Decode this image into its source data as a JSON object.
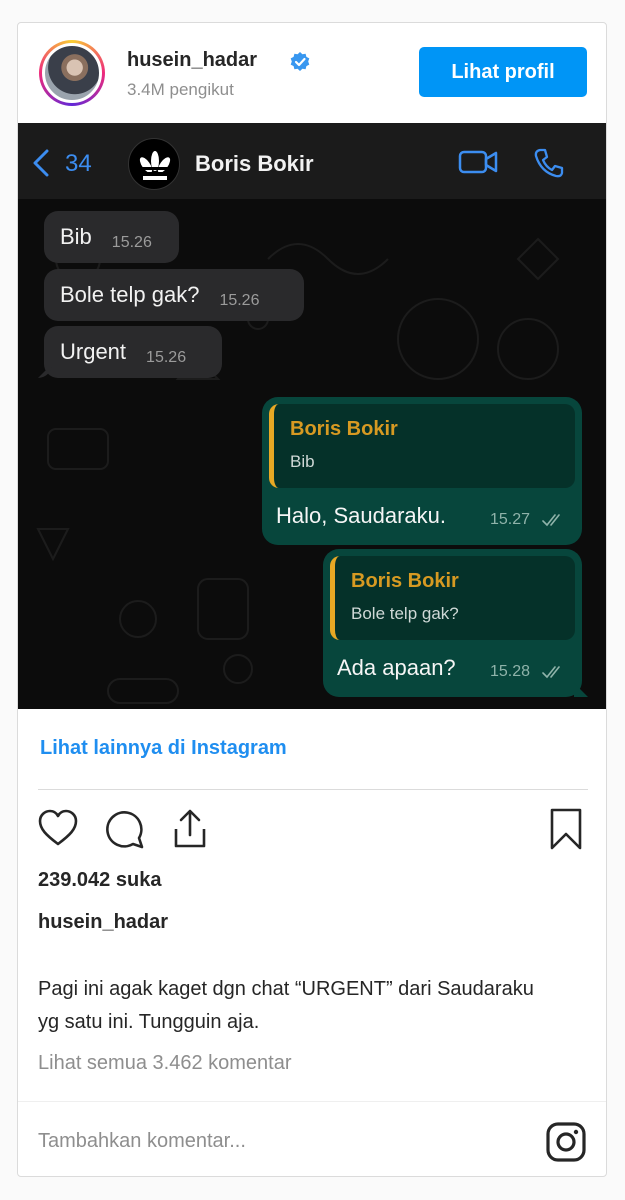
{
  "header": {
    "username": "husein_hadar",
    "followers": "3.4M pengikut",
    "view_profile_label": "Lihat profil",
    "verified_icon": "verified-badge-icon"
  },
  "chat": {
    "back_count": "34",
    "contact_name": "Boris Bokir",
    "incoming": [
      {
        "text": "Bib",
        "time": "15.26"
      },
      {
        "text": "Bole telp gak?",
        "time": "15.26"
      },
      {
        "text": "Urgent",
        "time": "15.26"
      }
    ],
    "outgoing": [
      {
        "quote_name": "Boris Bokir",
        "quote_text": "Bib",
        "text": "Halo, Saudaraku.",
        "time": "15.27"
      },
      {
        "quote_name": "Boris Bokir",
        "quote_text": "Bole telp gak?",
        "text": "Ada apaan?",
        "time": "15.28"
      }
    ],
    "colors": {
      "accent_blue": "#3c8df0",
      "outgoing_bubble": "#07463c",
      "incoming_bubble": "#2a2a2c",
      "quote_bar": "#e8a824"
    }
  },
  "footer": {
    "more_link": "Lihat lainnya di Instagram",
    "likes": "239.042 suka",
    "caption_user": "husein_hadar",
    "caption": "Pagi ini agak kaget dgn chat “URGENT” dari Saudaraku yg satu ini. Tungguin aja.",
    "comments_link": "Lihat semua 3.462 komentar",
    "comment_placeholder": "Tambahkan komentar...",
    "colors": {
      "brand_blue": "#0095f6"
    }
  }
}
